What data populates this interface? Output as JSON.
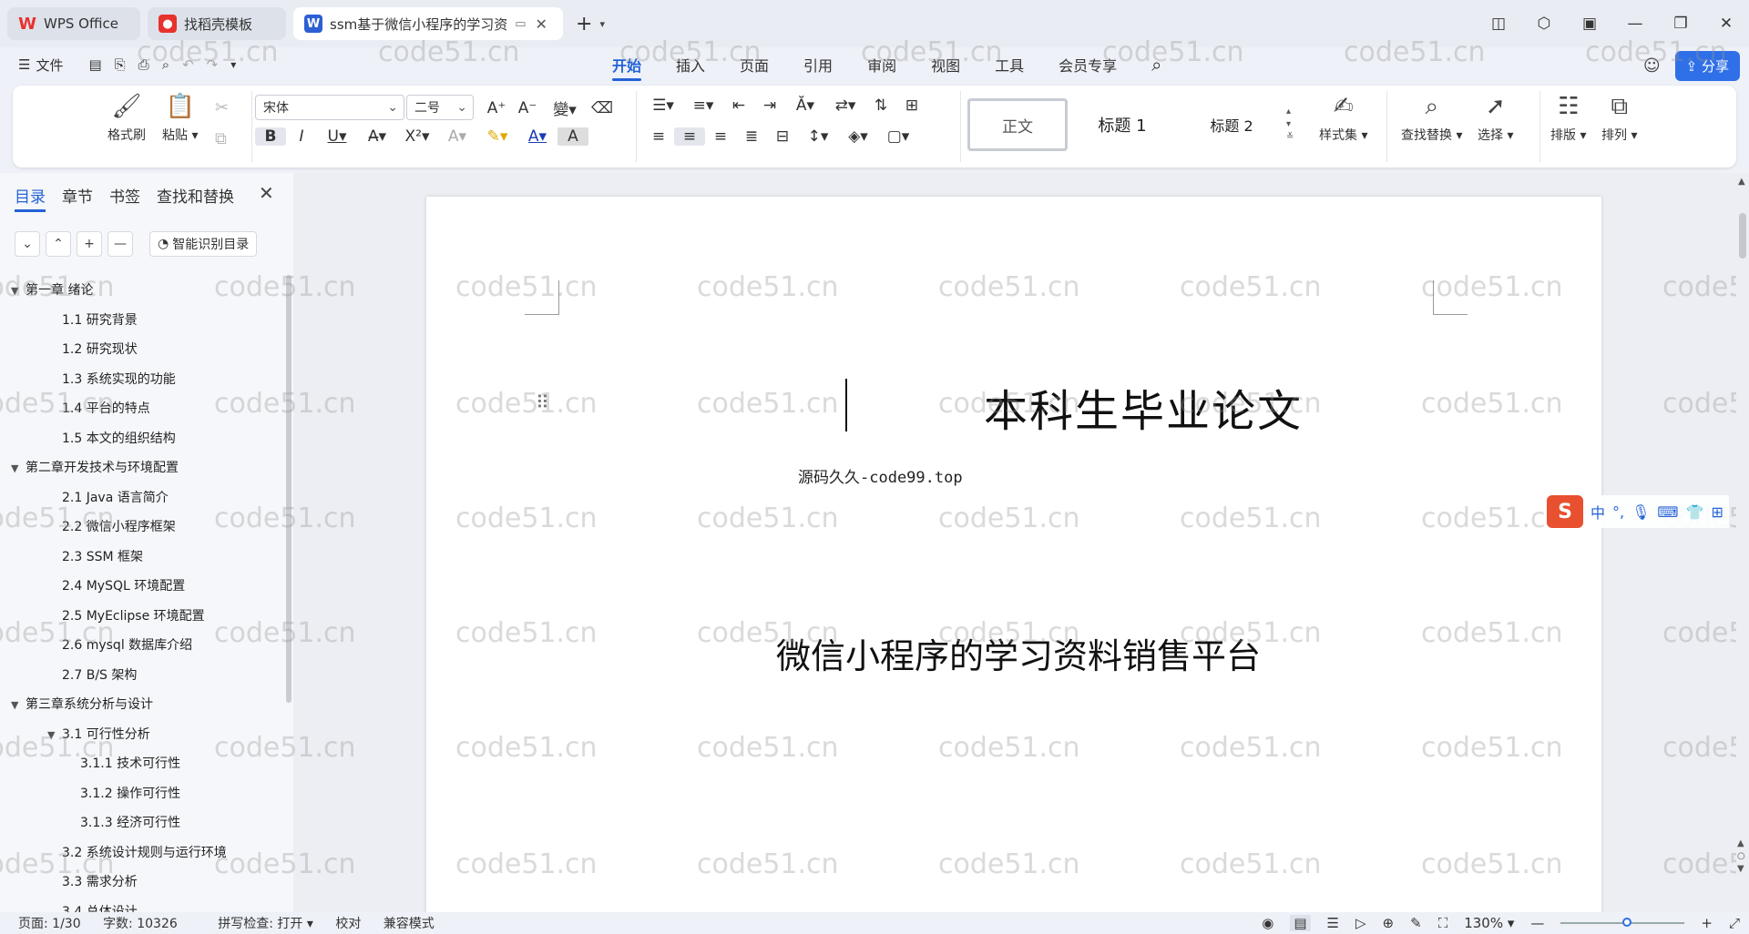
{
  "titlebar": {
    "tabs": [
      {
        "label": "WPS Office",
        "icon": "wps-logo-icon"
      },
      {
        "label": "找稻壳模板",
        "icon": "docer-icon"
      },
      {
        "label": "ssm基于微信小程序的学习资",
        "icon": "word-doc-icon"
      }
    ]
  },
  "menubar": {
    "file_label": "文件",
    "tabs": [
      "开始",
      "插入",
      "页面",
      "引用",
      "审阅",
      "视图",
      "工具",
      "会员专享"
    ],
    "share_label": "分享"
  },
  "ribbon": {
    "format_painter": "格式刷",
    "paste": "粘贴",
    "font_name": "宋体",
    "font_size": "二号",
    "styles": [
      "正文",
      "标题 1",
      "标题 2"
    ],
    "style_set": "样式集",
    "find_replace": "查找替换",
    "select": "选择",
    "layout": "排版",
    "arrange": "排列"
  },
  "sidebar": {
    "tabs": [
      "目录",
      "章节",
      "书签",
      "查找和替换"
    ],
    "smart_toc": "智能识别目录",
    "toc": [
      {
        "text": "第一章 绪论",
        "level": 0,
        "expanded": true
      },
      {
        "text": "1.1    研究背景",
        "level": 1
      },
      {
        "text": "1.2    研究现状",
        "level": 1
      },
      {
        "text": "1.3    系统实现的功能",
        "level": 1
      },
      {
        "text": "1.4    平台的特点",
        "level": 1
      },
      {
        "text": "1.5    本文的组织结构",
        "level": 1
      },
      {
        "text": "第二章开发技术与环境配置",
        "level": 0,
        "expanded": true
      },
      {
        "text": "2.1    Java 语言简介",
        "level": 1
      },
      {
        "text": "2.2    微信小程序框架",
        "level": 1
      },
      {
        "text": "2.3    SSM 框架",
        "level": 1
      },
      {
        "text": "2.4    MySQL 环境配置",
        "level": 1
      },
      {
        "text": "2.5    MyEclipse 环境配置",
        "level": 1
      },
      {
        "text": "2.6    mysql 数据库介绍",
        "level": 1
      },
      {
        "text": "2.7    B/S 架构",
        "level": 1
      },
      {
        "text": "第三章系统分析与设计",
        "level": 0,
        "expanded": true
      },
      {
        "text": "3.1  可行性分析",
        "level": 1,
        "expanded": true
      },
      {
        "text": "3.1.1 技术可行性",
        "level": 2
      },
      {
        "text": "3.1.2 操作可行性",
        "level": 2
      },
      {
        "text": "3.1.3 经济可行性",
        "level": 2
      },
      {
        "text": "3.2    系统设计规则与运行环境",
        "level": 1
      },
      {
        "text": "3.3    需求分析",
        "level": 1
      },
      {
        "text": "3.4    总体设计",
        "level": 1
      }
    ]
  },
  "document": {
    "heading": "本科生毕业论文",
    "source_line": "源码久久-code99.top",
    "subtitle": "微信小程序的学习资料销售平台",
    "watermark": "code51.cn"
  },
  "ime": {
    "mode": "中",
    "punct": "°,"
  },
  "statusbar": {
    "page": "页面: 1/30",
    "words": "字数: 10326",
    "spellcheck": "拼写检查: 打开",
    "proofread": "校对",
    "compat": "兼容模式",
    "zoom": "130%"
  },
  "colors": {
    "accent": "#2362d6",
    "share": "#2f6fe8",
    "wps_red": "#e8322d",
    "word_blue": "#2c5fd4"
  }
}
